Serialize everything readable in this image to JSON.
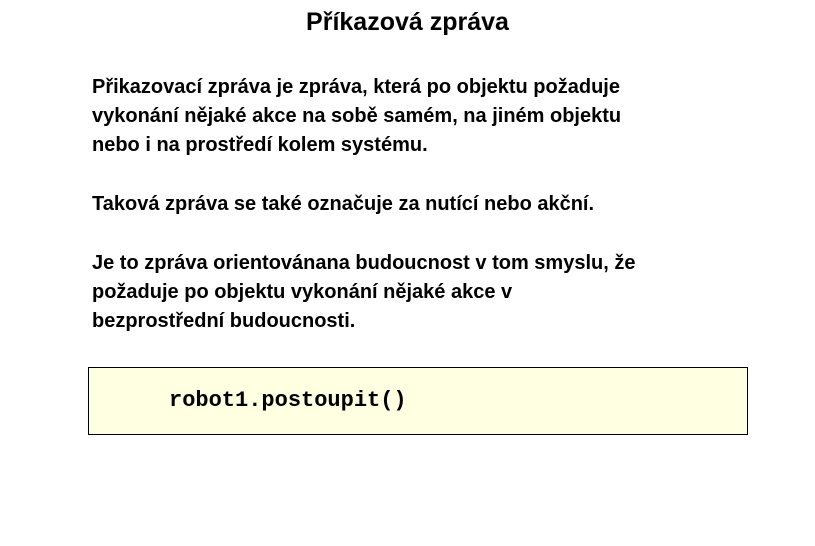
{
  "slide": {
    "title": "Příkazová zpráva",
    "paragraphs": [
      {
        "lines": [
          "Přikazovací zpráva je zpráva, která po objektu požaduje",
          "vykonání nějaké akce na sobě samém, na jiném objektu",
          "nebo i na prostředí kolem systému."
        ]
      },
      {
        "lines": [
          "Taková zpráva se také označuje za nutící nebo akční."
        ]
      },
      {
        "lines": [
          "Je to zpráva orientovánana budoucnost v tom smyslu, že",
          "požaduje po objektu vykonání nějaké akce v",
          "bezprostřední budoucnosti."
        ]
      }
    ],
    "code_example": "robot1.postoupit()",
    "colors": {
      "background": "#ffffff",
      "text": "#000000",
      "code_box_background": "#ffffe1",
      "code_box_border": "#000000"
    }
  }
}
